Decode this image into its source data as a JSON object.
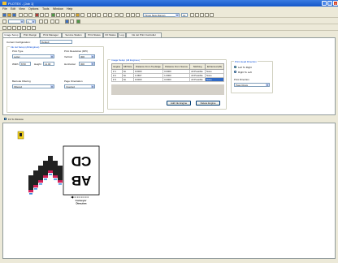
{
  "window": {
    "title": "PLOTEX - [Job 1]"
  },
  "menu": [
    "File",
    "Edit",
    "View",
    "Options",
    "Tools",
    "Window",
    "Help"
  ],
  "toolbar": {
    "font_box": "Times New Roman",
    "value_a": "1",
    "value_b": "12"
  },
  "tabs": [
    "Image Setup",
    "Print Design",
    "Print Manager",
    "Service Station",
    "Print Status",
    "I/O Status",
    "Log",
    "Ink Jet Print Controller"
  ],
  "config": {
    "label": "Current Configuration:",
    "value": "Default"
  },
  "ink_jet": {
    "group_title": "Ink Jet Setup (All Engines)",
    "print_type_label": "Print Type",
    "print_type": "Letter",
    "print_resolution_label": "Print Resolution (DPI)",
    "vertical_label": "Vertical",
    "vertical": "300",
    "horizontal_label": "Horizontal",
    "horizontal": "300",
    "width_label": "Width",
    "width": "8.50",
    "height_label": "Height",
    "height": "11.00",
    "barcode_label": "Barcode Filtering",
    "barcode": "Filtered",
    "page_orient_label": "Page Orientation",
    "page_orient": "Inverted"
  },
  "engine_table": {
    "group_title": "Image Setup (All Engines)",
    "headers": [
      "Engine",
      "Mfr/Size",
      "Distance From Top Edge",
      "Distance From Source",
      "Stitching",
      "Enhanced (20)"
    ],
    "rows": [
      [
        "# 1",
        "No",
        "0.0000",
        "0.0000",
        "All Possible",
        "None"
      ],
      [
        "# 2",
        "No",
        "1.0667",
        "1.0000",
        "All Possible",
        "None"
      ],
      [
        "# 3",
        "No",
        "0.0000",
        "0.0000",
        "All Possible",
        "None"
      ]
    ],
    "selected_cell": "None",
    "add_button": "Add Ink Engine",
    "delete_button": "Delete Engine"
  },
  "print_direction": {
    "group_title": "Print Head Direction",
    "option_a": "Left To Right",
    "option_b": "Right To Left",
    "doc_label": "Print Direction",
    "doc_value": "Pass Rows"
  },
  "fit_window": "Fit To Window",
  "canvas": {
    "label_top": "CD",
    "label_bottom": "AB",
    "conveyor": "Conveyor\nDirection"
  },
  "colors": {
    "accent": "#316ac5",
    "title": "#1456c8",
    "panel": "#ece9d8"
  }
}
